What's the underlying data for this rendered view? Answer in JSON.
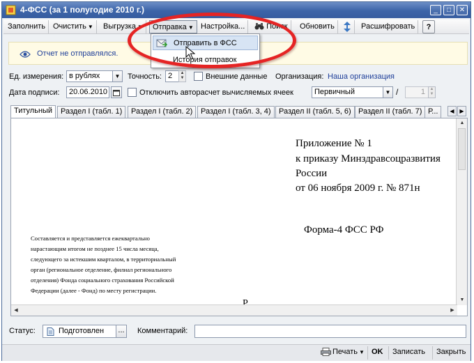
{
  "window": {
    "title": "4-ФСС (за 1 полугодие 2010 г.)",
    "controls": {
      "minimize": "_",
      "maximize": "□",
      "close": "✕"
    }
  },
  "toolbar": {
    "fill": "Заполнить",
    "clear": "Очистить",
    "export": "Выгрузка",
    "send": "Отправка",
    "settings": "Настройка...",
    "search": "Поиск",
    "refresh": "Обновить",
    "decode": "Расшифровать",
    "help": "?"
  },
  "send_menu": {
    "items": [
      {
        "label": "Отправить в ФСС"
      },
      {
        "label": "История отправок"
      }
    ]
  },
  "notice": {
    "text": "Отчет не отправлялся."
  },
  "form": {
    "unit_label": "Ед. измерения:",
    "unit_value": "в рублях",
    "precision_label": "Точность:",
    "precision_value": "2",
    "external_data_label": "Внешние данные",
    "org_label": "Организация:",
    "org_value": "Наша организация",
    "sign_date_label": "Дата подписи:",
    "sign_date_value": "20.06.2010",
    "disable_autocalc_label": "Отключить авторасчет вычисляемых ячеек",
    "report_kind_value": "Первичный",
    "slash": "/",
    "correction_number": "1"
  },
  "tabs": [
    {
      "label": "Титульный"
    },
    {
      "label": "Раздел I (табл. 1)"
    },
    {
      "label": "Раздел I (табл. 2)"
    },
    {
      "label": "Раздел I (табл. 3, 4)"
    },
    {
      "label": "Раздел II (табл. 5, 6)"
    },
    {
      "label": "Раздел II (табл. 7)"
    },
    {
      "label": "Р..."
    }
  ],
  "document": {
    "appendix_lines": [
      "Приложение № 1",
      "к приказу Минздравсоцразвития",
      "России",
      "от 06 ноября 2009 г. № 871н"
    ],
    "form_title": "Форма-4 ФСС РФ",
    "small_text_lines": [
      "Составляется и представляется ежеквартально",
      "нарастающим итогом не позднее 15 числа месяца,",
      "следующего за истекшим кварталом, в территориальный",
      "орган (региональное отделение, филиал регионального",
      "отделения) Фонда социального страхования Российской",
      "Федерации (далее - Фонд)  по месту регистрации."
    ],
    "cut_char": "Р"
  },
  "bottom": {
    "status_label": "Статус:",
    "status_value": "Подготовлен",
    "status_btn": "...",
    "comment_label": "Комментарий:",
    "comment_value": ""
  },
  "footer": {
    "print": "Печать",
    "ok": "OK",
    "save": "Записать",
    "close": "Закрыть"
  },
  "colors": {
    "title_bar": "#3c64a8",
    "annotation": "#e52424",
    "link": "#1f3f99",
    "notice_bg": "#fffbe5"
  }
}
